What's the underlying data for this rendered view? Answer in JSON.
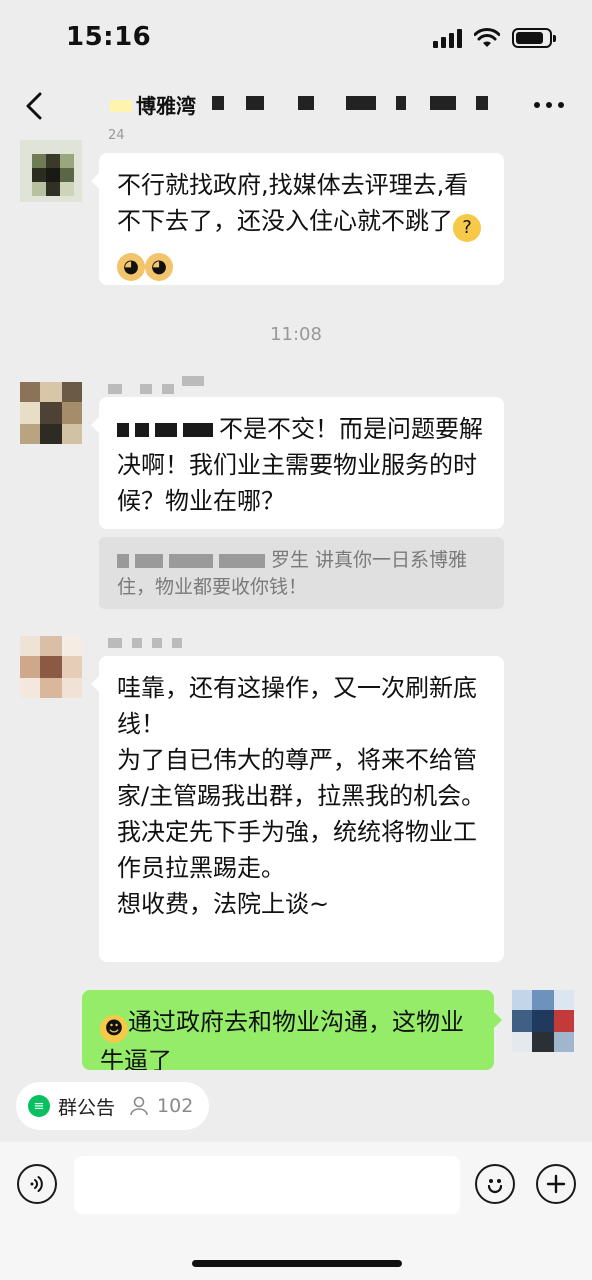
{
  "status": {
    "time": "15:16",
    "battery_level": 0.85
  },
  "nav": {
    "title": "博雅湾"
  },
  "messages": [
    {
      "name": "24",
      "text": "不行就找政府,找媒体去评理去,看不下去了，还没入住心就不跳了"
    },
    {
      "name": "",
      "text": "不是不交！而是问题要解决啊！我们业主需要物业服务的时候？物业在哪？",
      "quote": "罗生 讲真你一日系博雅住，物业都要收你钱！"
    },
    {
      "name": "",
      "text": "哇靠，还有这操作，又一次刷新底线！\n为了自已伟大的尊严，将来不给管家/主管踢我出群，拉黑我的机会。\n我决定先下手为強，统统将物业工作员拉黑踢走。\n想收费，法院上谈~"
    },
    {
      "name": "",
      "text": "通过政府去和物业沟通，这物业牛逼了"
    }
  ],
  "time_separator": "11:08",
  "announcement": {
    "label": "群公告",
    "member_count": "102"
  },
  "colors": {
    "bg": "#ededed",
    "bubble_in": "#ffffff",
    "bubble_out": "#95ec69",
    "accent": "#07c160"
  },
  "icons": [
    "back-arrow-icon",
    "more-dots-icon",
    "voice-icon",
    "emoji-icon",
    "plus-icon",
    "announcement-icon",
    "person-icon"
  ]
}
